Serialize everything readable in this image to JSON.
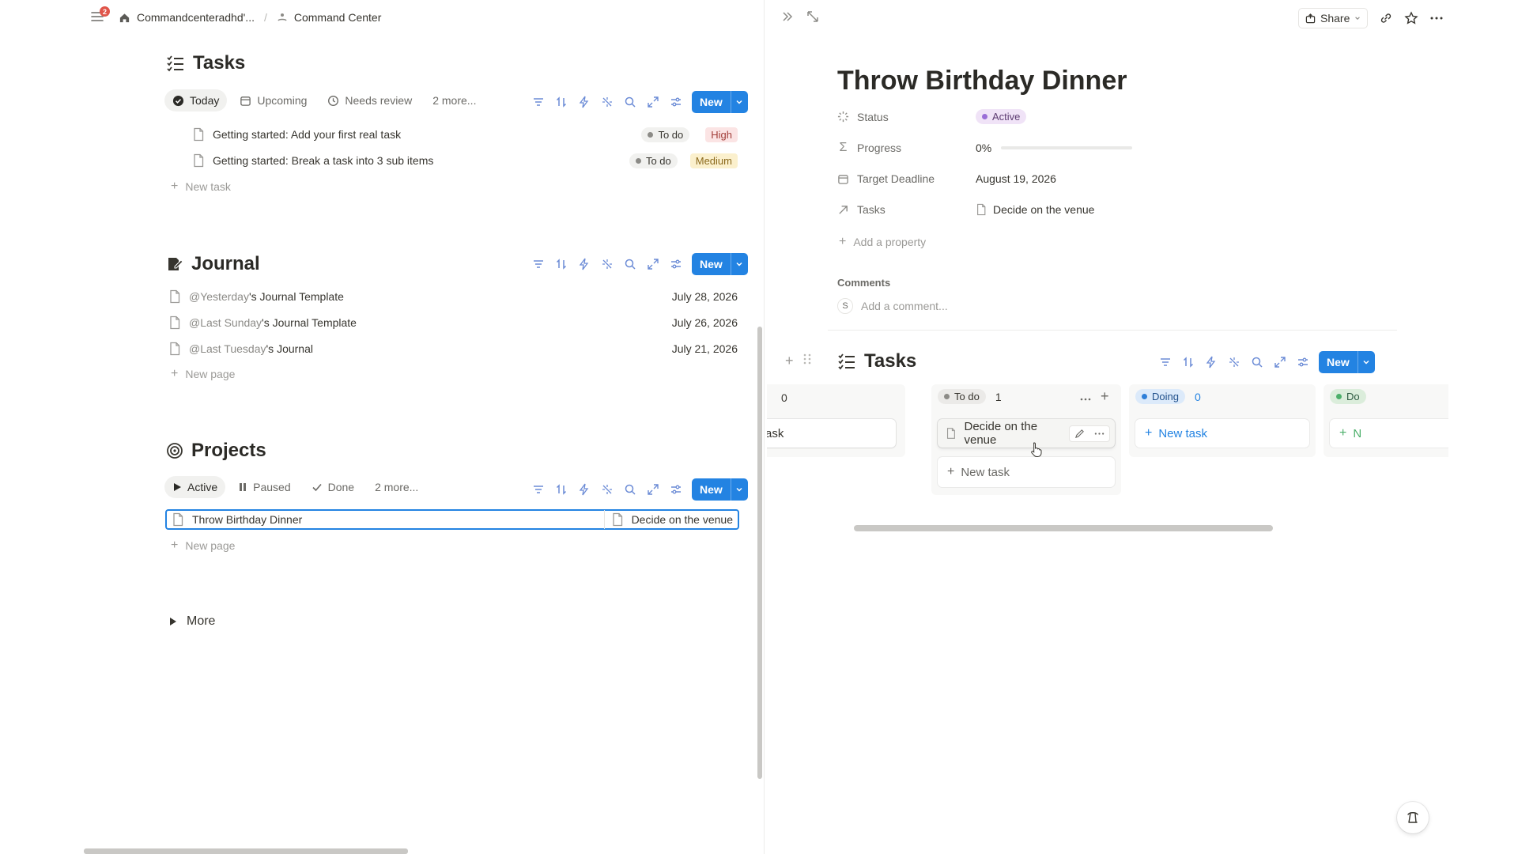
{
  "breadcrumb": {
    "notification_count": "2",
    "workspace": "Commandcenteradhd'...",
    "separator": "/",
    "page": "Command Center"
  },
  "tasks_section": {
    "title": "Tasks",
    "tabs": [
      "Today",
      "Upcoming",
      "Needs review",
      "2 more..."
    ],
    "new_label": "New",
    "rows": [
      {
        "title": "Getting started: Add your first real task",
        "status": "To do",
        "priority": "High"
      },
      {
        "title": "Getting started: Break a task into 3 sub items",
        "status": "To do",
        "priority": "Medium"
      }
    ],
    "add_label": "New task"
  },
  "journal_section": {
    "title": "Journal",
    "new_label": "New",
    "rows": [
      {
        "mention": "@Yesterday",
        "rest": "'s Journal Template",
        "date": "July 28, 2026"
      },
      {
        "mention": "@Last Sunday",
        "rest": "'s Journal Template",
        "date": "July 26, 2026"
      },
      {
        "mention": "@Last Tuesday",
        "rest": "'s Journal",
        "date": "July 21, 2026"
      }
    ],
    "add_label": "New page"
  },
  "projects_section": {
    "title": "Projects",
    "tabs": [
      "Active",
      "Paused",
      "Done",
      "2 more..."
    ],
    "new_label": "New",
    "rows": [
      {
        "title": "Throw Birthday Dinner",
        "task": "Decide on the venue"
      }
    ],
    "add_label": "New page"
  },
  "more_label": "More",
  "detail": {
    "share_label": "Share",
    "title": "Throw Birthday Dinner",
    "properties": {
      "status": {
        "label": "Status",
        "value": "Active"
      },
      "progress": {
        "label": "Progress",
        "value": "0%",
        "fraction": 0
      },
      "deadline": {
        "label": "Target Deadline",
        "value": "August 19, 2026"
      },
      "tasks": {
        "label": "Tasks",
        "value": "Decide on the venue"
      }
    },
    "add_property": "Add a property",
    "comments_label": "Comments",
    "comment_avatar": "S",
    "comment_placeholder": "Add a comment...",
    "board": {
      "title": "Tasks",
      "new_label": "New",
      "partial_count": "0",
      "partial_card": "ask",
      "todo": {
        "label": "To do",
        "count": "1",
        "card": "Decide on the venue",
        "add": "New task"
      },
      "doing": {
        "label": "Doing",
        "count": "0",
        "add": "New task"
      },
      "cut_col": {
        "label": "Do",
        "add": "N"
      }
    }
  },
  "colors": {
    "accent": "#2383e2",
    "high_tag": "#fbe4e4",
    "medium_tag": "#fbf0cd",
    "active_pill": "#f0e3f7",
    "doing_pill": "#dceafa"
  }
}
